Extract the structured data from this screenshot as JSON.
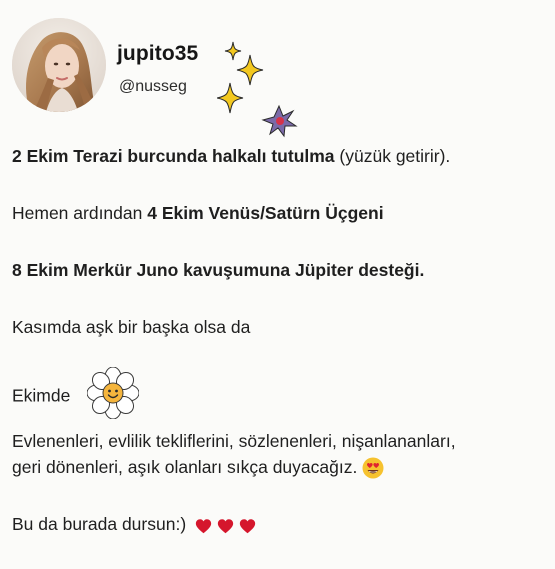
{
  "header": {
    "display_name": "jupito35",
    "handle": "@nusseg"
  },
  "post": {
    "line1_bold": "2 Ekim Terazi burcunda halkalı tutulma",
    "line1_rest": " (yüzük getirir).",
    "line2_plain": "Hemen ardından ",
    "line2_bold": "4 Ekim Venüs/Satürn Üçgeni",
    "line3_bold": "8 Ekim Merkür Juno kavuşumuna Jüpiter desteği.",
    "line4": "Kasımda aşk bir başka olsa da",
    "line5": "Ekimde",
    "line6a": "Evlenenleri, evlilik tekliflerini, sözlenenleri, nişanlananları,",
    "line6b": "geri dönenleri, aşık olanları sıkça duyacağız.",
    "line7": "Bu da burada dursun:)"
  },
  "icons": {
    "sparkle_color": "#f3c81f",
    "star_color": "#7b6aa8",
    "star_center_color": "#d6334a",
    "heart_color": "#d5162c",
    "flower_center": "#f5b53d",
    "emoji_face": "#f6c22f",
    "emoji_heart": "#e0242f"
  }
}
